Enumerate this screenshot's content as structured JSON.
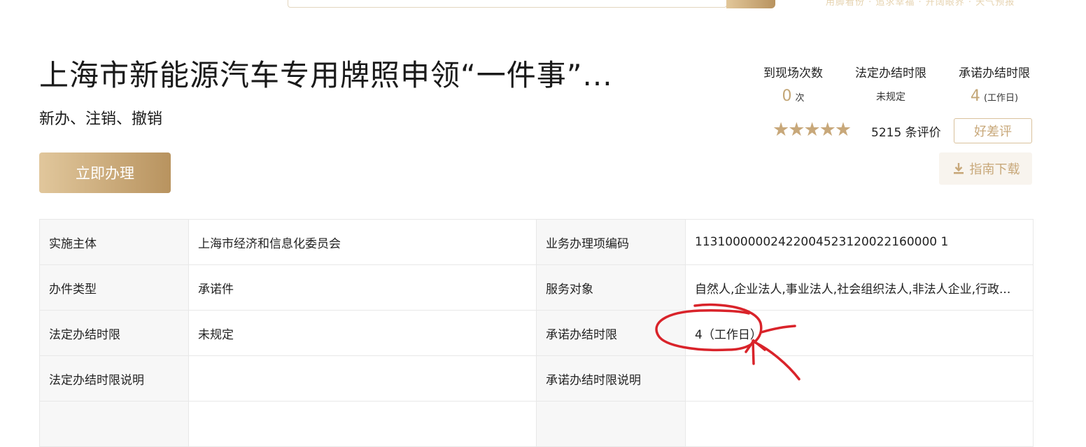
{
  "header": {
    "top_tags": "用脚看份 · 追求幸福 · 开阔眼界 · 天气预报"
  },
  "service": {
    "title": "上海市新能源汽车专用牌照申领“一件事”...",
    "subtitle": "新办、注销、撤销",
    "apply_label": "立即办理"
  },
  "stats": [
    {
      "label": "到现场次数",
      "value": "0",
      "unit": "次"
    },
    {
      "label": "法定办结时限",
      "value": "未规定",
      "unit": ""
    },
    {
      "label": "承诺办结时限",
      "value": "4",
      "unit": "(工作日)"
    }
  ],
  "rating": {
    "stars": 5,
    "count_text": "5215 条评价",
    "rate_label": "好差评",
    "guide_label": "指南下载"
  },
  "colors": {
    "accent": "#c8a87a",
    "accent_dark": "#b8935f",
    "annotation": "#d9232a"
  },
  "table": {
    "rows": [
      [
        "实施主体",
        "上海市经济和信息化委员会",
        "业务办理项编码",
        "11310000002422004523120022160000 1"
      ],
      [
        "办件类型",
        "承诺件",
        "服务对象",
        "自然人,企业法人,事业法人,社会组织法人,非法人企业,行政..."
      ],
      [
        "法定办结时限",
        "未规定",
        "承诺办结时限",
        "4（工作日）"
      ],
      [
        "法定办结时限说明",
        "",
        "承诺办结时限说明",
        ""
      ],
      [
        "",
        "",
        "",
        ""
      ]
    ]
  }
}
